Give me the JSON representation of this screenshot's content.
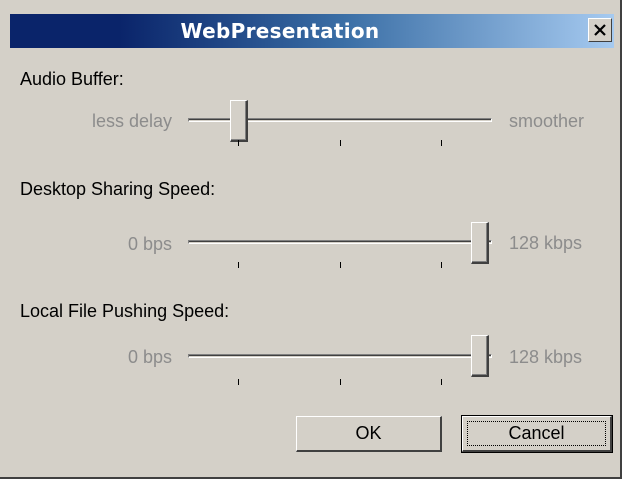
{
  "window": {
    "title": "WebPresentation"
  },
  "titlebar": {
    "close_icon": "close-icon"
  },
  "audio_buffer": {
    "label": "Audio Buffer:",
    "min_label": "less delay",
    "max_label": "smoother",
    "value_fraction": 0.12,
    "tick_count": 3
  },
  "desktop_sharing": {
    "label": "Desktop Sharing Speed:",
    "min_label": "0 bps",
    "max_label": "128 kbps",
    "value_fraction": 1.0,
    "tick_count": 3
  },
  "file_pushing": {
    "label": "Local File Pushing Speed:",
    "min_label": "0 bps",
    "max_label": "128 kbps",
    "value_fraction": 1.0,
    "tick_count": 3
  },
  "buttons": {
    "ok": "OK",
    "cancel": "Cancel"
  },
  "colors": {
    "titlebar_start": "#0a246a",
    "titlebar_end": "#a6caf0",
    "dialog_background": "#d4d0c8",
    "disabled_text": "#8c8c8c"
  }
}
